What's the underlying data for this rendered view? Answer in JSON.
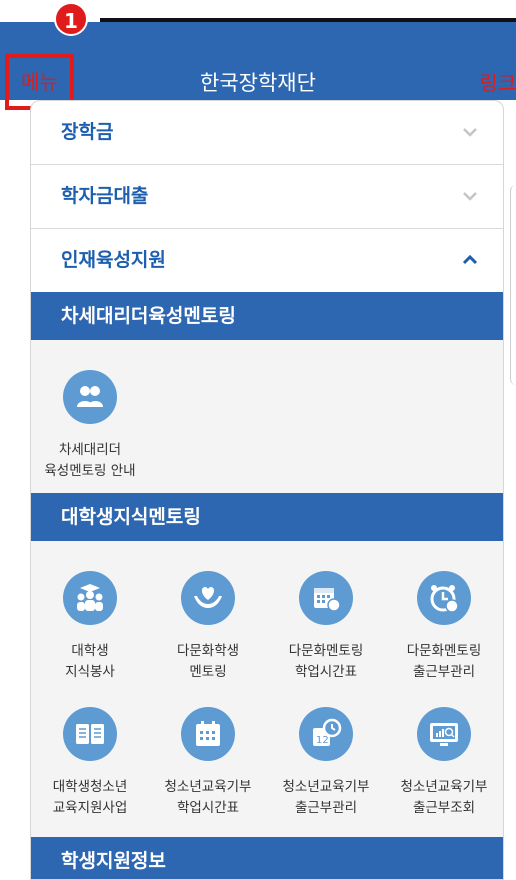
{
  "header": {
    "menu_label": "메뉴",
    "title": "한국장학재단",
    "link_label": "링크",
    "badge": "1"
  },
  "accordion": [
    {
      "label": "장학금",
      "state": "collapsed"
    },
    {
      "label": "학자금대출",
      "state": "collapsed"
    },
    {
      "label": "인재육성지원",
      "state": "expanded"
    }
  ],
  "sections": {
    "mentoring": {
      "title": "차세대리더육성멘토링",
      "items": [
        {
          "line1": "차세대리더",
          "line2": "육성멘토링 안내",
          "icon": "people-icon"
        }
      ]
    },
    "knowledge": {
      "title": "대학생지식멘토링",
      "items": [
        {
          "line1": "대학생",
          "line2": "지식봉사",
          "icon": "graduates-icon"
        },
        {
          "line1": "다문화학생",
          "line2": "멘토링",
          "icon": "heart-hands-icon"
        },
        {
          "line1": "다문화멘토링",
          "line2": "학업시간표",
          "icon": "calendar-globe-icon"
        },
        {
          "line1": "다문화멘토링",
          "line2": "출근부관리",
          "icon": "alarm-clock-icon"
        },
        {
          "line1": "대학생청소년",
          "line2": "교육지원사업",
          "icon": "book-icon"
        },
        {
          "line1": "청소년교육기부",
          "line2": "학업시간표",
          "icon": "calendar-icon"
        },
        {
          "line1": "청소년교육기부",
          "line2": "출근부관리",
          "icon": "calendar-clock-icon"
        },
        {
          "line1": "청소년교육기부",
          "line2": "출근부조회",
          "icon": "monitor-search-icon"
        }
      ]
    },
    "student_info": {
      "title": "학생지원정보"
    }
  },
  "colors": {
    "header_bg": "#2e67b1",
    "accent_text": "#1d5fae",
    "icon_bg": "#5f9bd3",
    "annotation_red": "#e01b1b",
    "grid_bg": "#f4f4f4"
  }
}
